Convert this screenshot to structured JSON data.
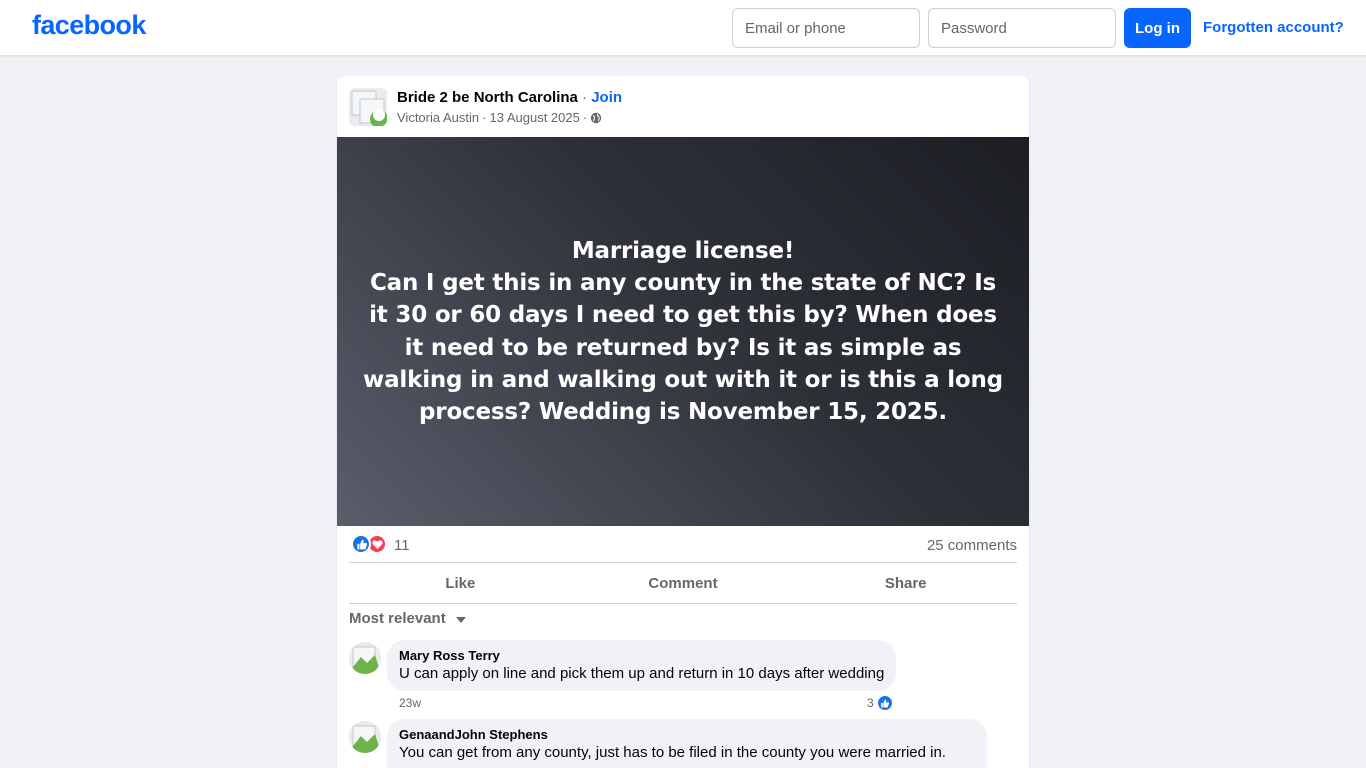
{
  "header": {
    "logo": "facebook",
    "email_placeholder": "Email or phone",
    "password_placeholder": "Password",
    "login_label": "Log in",
    "forgot_label": "Forgotten account?"
  },
  "post": {
    "group_name": "Bride 2 be North Carolina",
    "separator": " · ",
    "join_label": "Join",
    "author": "Victoria Austin",
    "date": "13 August 2025",
    "audience_icon": "globe-icon",
    "text": "Marriage license!\nCan I get this in any county in the state of NC? Is it 30 or 60 days I need to get this by? When does it need to be returned by? Is it as simple as walking in and walking out with it or is this a long process? Wedding is November 15, 2025.",
    "background_colors": [
      "#5a5e6c",
      "#1c1e24"
    ],
    "reaction_icons": [
      "like-icon",
      "love-icon"
    ],
    "reaction_count": "11",
    "comments_count": "25 comments"
  },
  "actions": {
    "like": "Like",
    "comment": "Comment",
    "share": "Share"
  },
  "comments_section": {
    "sort_label": "Most relevant",
    "items": [
      {
        "author": "Mary Ross Terry",
        "text": "U can apply on line and pick them up and return in 10 days after wedding",
        "time": "23w",
        "likes": "3"
      },
      {
        "author": "GenaandJohn Stephens",
        "text": "You can get from any county, just has to be filed in the county you were married in."
      }
    ]
  },
  "colors": {
    "brand": "#0866ff",
    "like": "#1b74e4",
    "love": "#f33e58"
  }
}
